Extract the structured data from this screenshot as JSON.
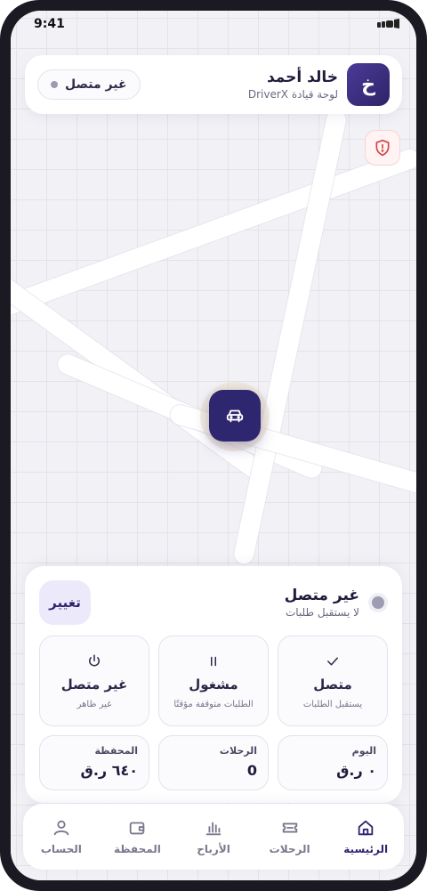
{
  "status_bar": {
    "time": "9:41"
  },
  "driver": {
    "initial": "خ",
    "name": "خالد أحمد",
    "subtitle": "لوحة قيادة DriverX",
    "status_label": "غير متصل"
  },
  "panel": {
    "status_title": "غير متصل",
    "status_sub": "لا يستقبل طلبات",
    "change_label": "تغيير",
    "options": [
      {
        "title": "متصل",
        "sub": "يستقبل الطلبات",
        "icon": "check-icon"
      },
      {
        "title": "مشغول",
        "sub": "الطلبات متوقفة مؤقتًا",
        "icon": "pause-icon"
      },
      {
        "title": "غير متصل",
        "sub": "غير ظاهر",
        "icon": "power-icon"
      }
    ],
    "stats": [
      {
        "label": "اليوم",
        "value": "٠ ر.ق"
      },
      {
        "label": "الرحلات",
        "value": "0"
      },
      {
        "label": "المحفظة",
        "value": "٦٤٠ ر.ق"
      }
    ]
  },
  "nav": [
    {
      "label": "الرئيسية",
      "icon": "home-icon",
      "active": true
    },
    {
      "label": "الرحلات",
      "icon": "ticket-icon",
      "active": false
    },
    {
      "label": "الأرباح",
      "icon": "bar-chart-icon",
      "active": false
    },
    {
      "label": "المحفظة",
      "icon": "wallet-icon",
      "active": false
    },
    {
      "label": "الحساب",
      "icon": "user-icon",
      "active": false
    }
  ],
  "colors": {
    "accent": "#2f2670",
    "offline_dot": "#9d9cb2",
    "sos": "#d64545"
  }
}
